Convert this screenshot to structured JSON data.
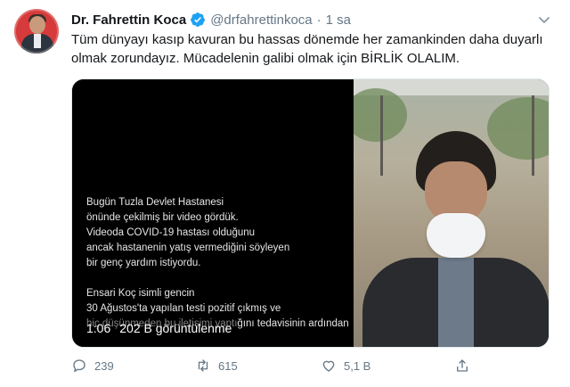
{
  "tweet": {
    "display_name": "Dr. Fahrettin Koca",
    "handle": "@drfahrettinkoca",
    "separator": "·",
    "time": "1 sa",
    "text": "Tüm dünyayı kasıp kavuran bu hassas dönemde her zamankinden daha duyarlı olmak zorundayız. Mücadelenin galibi olmak için BİRLİK OLALIM.",
    "verified": true
  },
  "video": {
    "embedded_text": "Bugün Tuzla Devlet Hastanesi\nönünde çekilmiş bir video gördük.\nVideoda COVID-19 hastası olduğunu\nancak hastanenin yatış vermediğini söyleyen\nbir genç yardım istiyordu.\n\nEnsari Koç isimli gencin\n30 Ağustos'ta yapılan testi pozitif çıkmış ve\nhiç düşünmeden bu iletişimi yaptığını tedavisinin ardından",
    "duration": "1:06",
    "views": "202 B görüntülenme"
  },
  "actions": {
    "reply_count": "239",
    "retweet_count": "615",
    "like_count": "5,1 B"
  },
  "colors": {
    "text": "#14171a",
    "secondary": "#657786",
    "verified": "#1da1f2",
    "avatar_bg": "#d63a3a"
  },
  "icons": [
    "verified-badge-icon",
    "caret-down-icon",
    "reply-icon",
    "retweet-icon",
    "like-icon",
    "share-icon"
  ]
}
